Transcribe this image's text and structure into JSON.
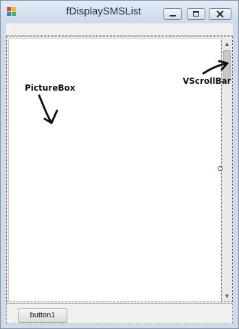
{
  "window": {
    "title": "fDisplaySMSList",
    "buttons": {
      "minimize": "minimize-icon",
      "maximize": "maximize-icon",
      "close": "close-icon"
    }
  },
  "annotations": {
    "picturebox_label": "PictureBox",
    "vscrollbar_label": "VScrollBar"
  },
  "bottom": {
    "button1_label": "button1"
  },
  "colors": {
    "titlebar": "#cfdbea",
    "client": "#f0f0f0",
    "picturebox": "#ffffff"
  }
}
